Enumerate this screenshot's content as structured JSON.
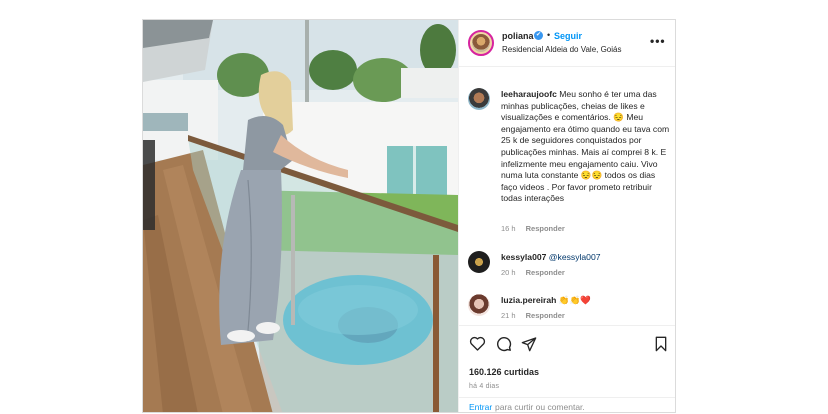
{
  "post": {
    "username": "poliana",
    "verified_badge": "✔",
    "separator": "•",
    "follow_label": "Seguir",
    "location": "Residencial Aldeia do Vale, Goiás",
    "more_icon": "•••"
  },
  "comments": [
    {
      "username": "leeharaujoofc",
      "text": " Meu sonho é ter uma das minhas publicações, cheias de likes e visualizações e comentários. 😔 Meu engajamento era ótimo quando eu tava com 25 k de seguidores conquistados por publicações minhas. Mais aí comprei 8 k. E infelizmente meu engajamento caiu. Vivo numa luta constante 😔😔 todos os dias faço videos . Por favor prometo retribuir todas interações",
      "time": "16 h",
      "reply": "Responder"
    },
    {
      "username": "kessyla007",
      "mention": "@kessyla007",
      "text": "",
      "time": "20 h",
      "reply": "Responder"
    },
    {
      "username": "luzia.pereirah",
      "text": " 👏👏❤️",
      "time": "21 h",
      "reply": "Responder"
    }
  ],
  "footer": {
    "likes": "160.126 curtidas",
    "time_ago": "há 4 dias",
    "login_link": "Entrar",
    "login_hint": "para curtir ou comentar."
  },
  "colors": {
    "accent": "#0095f6",
    "verified": "#3897f0",
    "muted": "#8e8e8e"
  }
}
